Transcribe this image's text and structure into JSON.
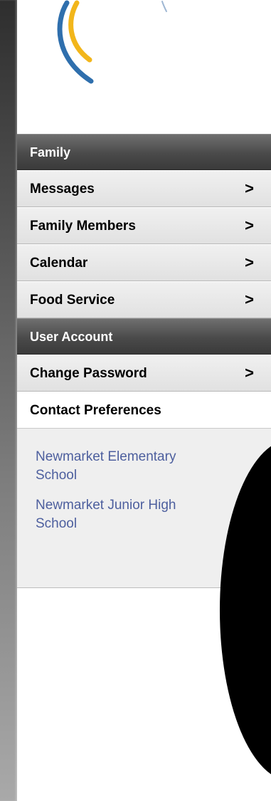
{
  "sidebar": {
    "sections": [
      {
        "header": "Family",
        "items": [
          {
            "label": "Messages",
            "chevron": ">"
          },
          {
            "label": "Family Members",
            "chevron": ">"
          },
          {
            "label": "Calendar",
            "chevron": ">"
          },
          {
            "label": "Food Service",
            "chevron": ">"
          }
        ]
      },
      {
        "header": "User Account",
        "items": [
          {
            "label": "Change Password",
            "chevron": ">"
          },
          {
            "label": "Contact Preferences"
          }
        ]
      }
    ]
  },
  "schools": [
    {
      "name": "Newmarket Elementary School"
    },
    {
      "name": "Newmarket Junior High School"
    }
  ],
  "colors": {
    "link": "#4d5f9e",
    "header_bg": "#4a4a4a",
    "item_bg": "#e6e6e6",
    "logo_blue": "#2f6fad",
    "logo_yellow": "#f2b61b"
  },
  "icons": {
    "logo": "swoosh-logo-icon",
    "chevron": "chevron-right-icon"
  }
}
